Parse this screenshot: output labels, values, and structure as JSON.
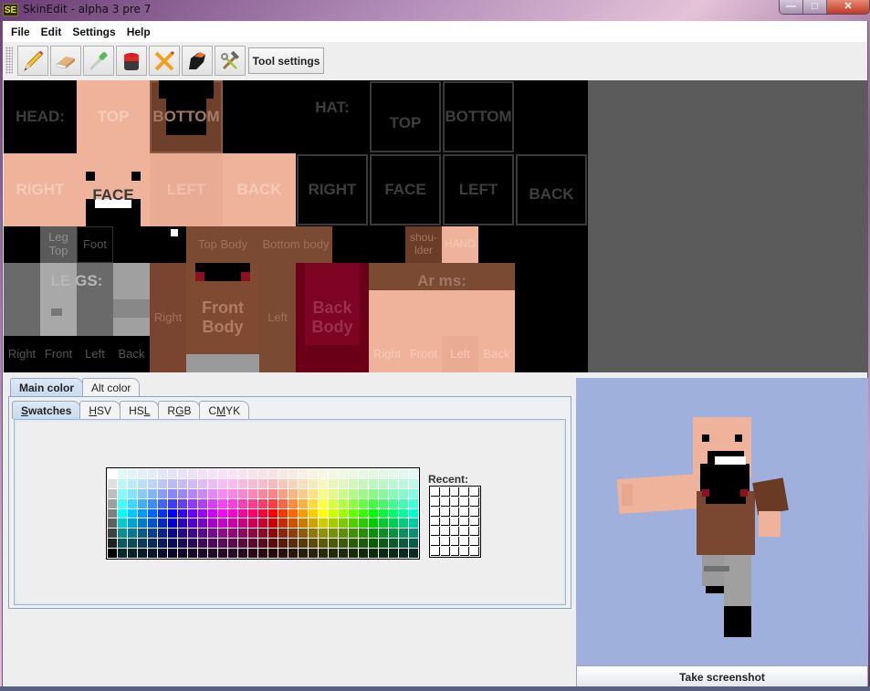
{
  "window": {
    "logo": "SE",
    "title": "SkinEdit - alpha 3 pre 7",
    "controls": [
      "minimize",
      "maximize",
      "close"
    ]
  },
  "menu": [
    "File",
    "Edit",
    "Settings",
    "Help"
  ],
  "toolbar": {
    "tools": [
      {
        "name": "pencil",
        "icon": "pencil-icon"
      },
      {
        "name": "eraser",
        "icon": "eraser-icon"
      },
      {
        "name": "eyedropper",
        "icon": "eyedropper-icon"
      },
      {
        "name": "bucket-fill",
        "icon": "paint-bucket-icon"
      },
      {
        "name": "cross-pencil",
        "icon": "crossed-pencil-icon"
      },
      {
        "name": "burn",
        "icon": "burn-icon"
      },
      {
        "name": "tools",
        "icon": "hammer-wrench-icon"
      }
    ],
    "tool_settings_label": "Tool settings"
  },
  "skin_layout": {
    "head": {
      "section": "HEAD:",
      "top": "TOP",
      "bottom": "BOTTOM",
      "right": "RIGHT",
      "face": "FACE",
      "left": "LEFT",
      "back": "BACK"
    },
    "hat": {
      "section": "HAT:",
      "top": "TOP",
      "bottom": "BOTTOM",
      "right": "RIGHT",
      "face": "FACE",
      "left": "LEFT",
      "back": "BACK"
    },
    "legs": {
      "section": "LE GS:",
      "leg_top": "Leg Top",
      "foot": "Foot",
      "right": "Right",
      "front": "Front",
      "left": "Left",
      "back": "Back"
    },
    "body": {
      "top": "Top Body",
      "bottom": "Bottom body",
      "right": "Right",
      "front": "Front Body",
      "left": "Left",
      "back": "Back Body"
    },
    "arms": {
      "section": "Ar ms:",
      "shoulder": "shou- lder",
      "hand": "HAND",
      "right": "Right",
      "front": "Front",
      "left": "Left",
      "back": "Back"
    }
  },
  "color_chooser": {
    "color_tabs": [
      {
        "label": "Main color",
        "active": true
      },
      {
        "label": "Alt color",
        "active": false
      }
    ],
    "mode_tabs": [
      {
        "pre": "",
        "u": "S",
        "post": "watches",
        "active": true
      },
      {
        "pre": "",
        "u": "H",
        "post": "SV",
        "active": false
      },
      {
        "pre": "HS",
        "u": "L",
        "post": "",
        "active": false
      },
      {
        "pre": "R",
        "u": "G",
        "post": "B",
        "active": false
      },
      {
        "pre": "C",
        "u": "M",
        "post": "YK",
        "active": false
      }
    ],
    "recent_label": "Recent:",
    "swatch_grid": {
      "columns": 31,
      "rows": 9
    },
    "recent_grid": {
      "columns": 5,
      "rows": 7
    }
  },
  "preview": {
    "background": "#a0b0dc",
    "screenshot_button": "Take screenshot"
  }
}
